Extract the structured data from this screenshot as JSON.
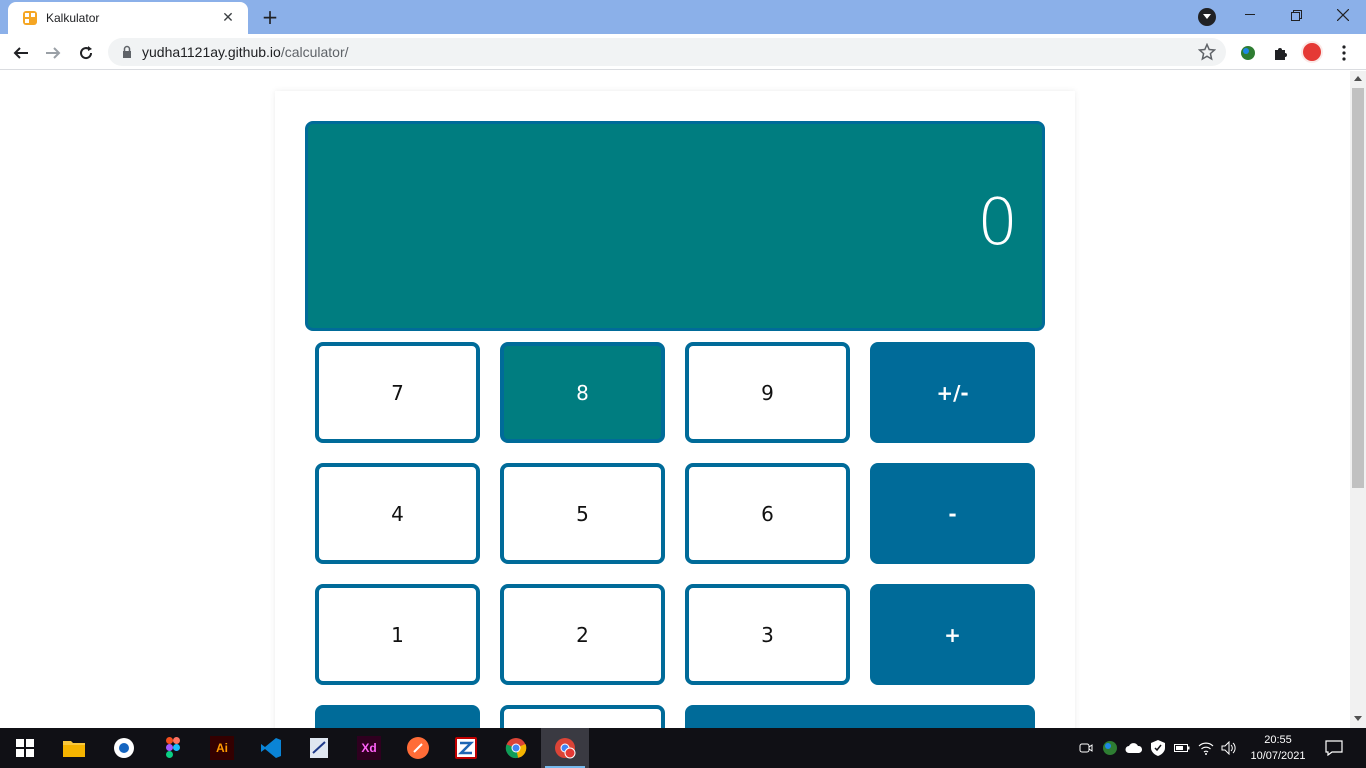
{
  "browser": {
    "tab_title": "Kalkulator",
    "url_host": "yudha1121ay.github.io",
    "url_path": "/calculator/"
  },
  "calculator": {
    "display_value": "0",
    "keys": {
      "k7": "7",
      "k8": "8",
      "k9": "9",
      "sign": "+/-",
      "k4": "4",
      "k5": "5",
      "k6": "6",
      "minus": "-",
      "k1": "1",
      "k2": "2",
      "k3": "3",
      "plus": "+"
    },
    "colors": {
      "primary": "#006b99",
      "display": "#007d80"
    }
  },
  "taskbar": {
    "time": "20:55",
    "date": "10/07/2021"
  }
}
